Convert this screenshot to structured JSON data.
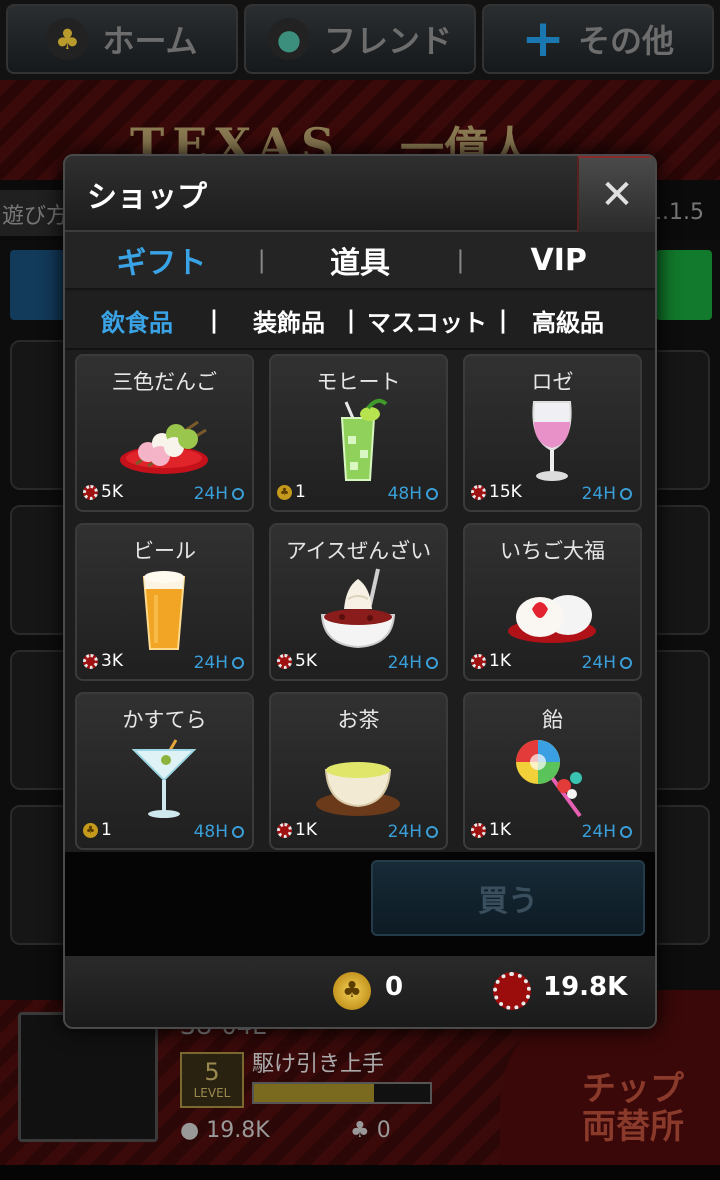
{
  "nav": {
    "home": "ホーム",
    "friends": "フレンド",
    "other": "その他"
  },
  "background": {
    "logo": "TEXAS",
    "logo_jp": "一億人",
    "play_label": "遊び方",
    "version": "1.1.5",
    "player_name": "SU-04E",
    "level_number": "5",
    "level_label": "LEVEL",
    "player_title": "駆け引き上手",
    "xp_fraction": 0.68,
    "chips": "19.8K",
    "gold": "0",
    "exchange_line1": "チップ",
    "exchange_line2": "両替所"
  },
  "shop": {
    "title": "ショップ",
    "close_symbol": "✕",
    "tabs": [
      {
        "label": "ギフト",
        "active": true
      },
      {
        "label": "道具",
        "active": false
      },
      {
        "label": "VIP",
        "active": false
      }
    ],
    "subtabs": [
      {
        "label": "飲食品",
        "active": true
      },
      {
        "label": "装飾品",
        "active": false
      },
      {
        "label": "マスコット",
        "active": false
      },
      {
        "label": "高級品",
        "active": false
      }
    ],
    "items": [
      {
        "name": "三色だんご",
        "price": "5K",
        "currency": "chip",
        "duration": "24H",
        "icon": "dango-icon"
      },
      {
        "name": "モヒート",
        "price": "1",
        "currency": "gold",
        "duration": "48H",
        "icon": "mojito-icon"
      },
      {
        "name": "ロゼ",
        "price": "15K",
        "currency": "chip",
        "duration": "24H",
        "icon": "rose-wine-icon"
      },
      {
        "name": "ビール",
        "price": "3K",
        "currency": "chip",
        "duration": "24H",
        "icon": "beer-icon"
      },
      {
        "name": "アイスぜんざい",
        "price": "5K",
        "currency": "chip",
        "duration": "24H",
        "icon": "ice-zenzai-icon"
      },
      {
        "name": "いちご大福",
        "price": "1K",
        "currency": "chip",
        "duration": "24H",
        "icon": "strawberry-daifuku-icon"
      },
      {
        "name": "かすてら",
        "price": "1",
        "currency": "gold",
        "duration": "48H",
        "icon": "martini-icon"
      },
      {
        "name": "お茶",
        "price": "1K",
        "currency": "chip",
        "duration": "24H",
        "icon": "tea-icon"
      },
      {
        "name": "飴",
        "price": "1K",
        "currency": "chip",
        "duration": "24H",
        "icon": "lollipop-icon"
      }
    ],
    "buy_label": "買う",
    "balance": {
      "gold": "0",
      "chips": "19.8K"
    }
  },
  "colors": {
    "accent": "#3aa3e6",
    "chip_red": "#9b0c0c",
    "gold": "#c59a1c"
  }
}
